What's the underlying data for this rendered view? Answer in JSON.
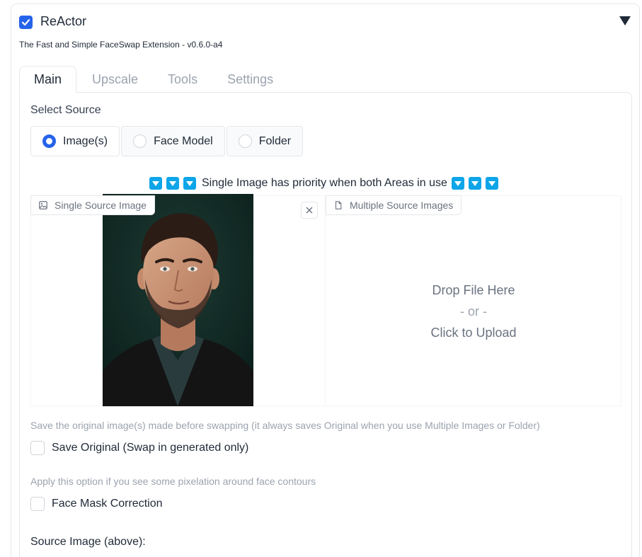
{
  "extension": {
    "title": "ReActor",
    "enabled": true,
    "subtitle": "The Fast and Simple FaceSwap Extension - v0.6.0-a4"
  },
  "tabs": [
    {
      "label": "Main",
      "active": true
    },
    {
      "label": "Upscale",
      "active": false
    },
    {
      "label": "Tools",
      "active": false
    },
    {
      "label": "Settings",
      "active": false
    }
  ],
  "source": {
    "label": "Select Source",
    "options": [
      "Image(s)",
      "Face Model",
      "Folder"
    ],
    "selected": "Image(s)"
  },
  "priority_note": "Single Image has priority when both Areas in use",
  "single_image": {
    "label": "Single Source Image"
  },
  "multi_images": {
    "label": "Multiple Source Images",
    "drop_text": "Drop File Here",
    "or_text": "- or -",
    "click_text": "Click to Upload"
  },
  "save_original": {
    "hint": "Save the original image(s) made before swapping (it always saves Original when you use Multiple Images or Folder)",
    "label": "Save Original (Swap in generated only)",
    "checked": false
  },
  "face_mask": {
    "hint": "Apply this option if you see some pixelation around face contours",
    "label": "Face Mask Correction",
    "checked": false
  },
  "source_image_label": "Source Image (above):",
  "colors": {
    "accent": "#2563eb",
    "info": "#0ea5e9",
    "muted": "#9ca3af"
  }
}
